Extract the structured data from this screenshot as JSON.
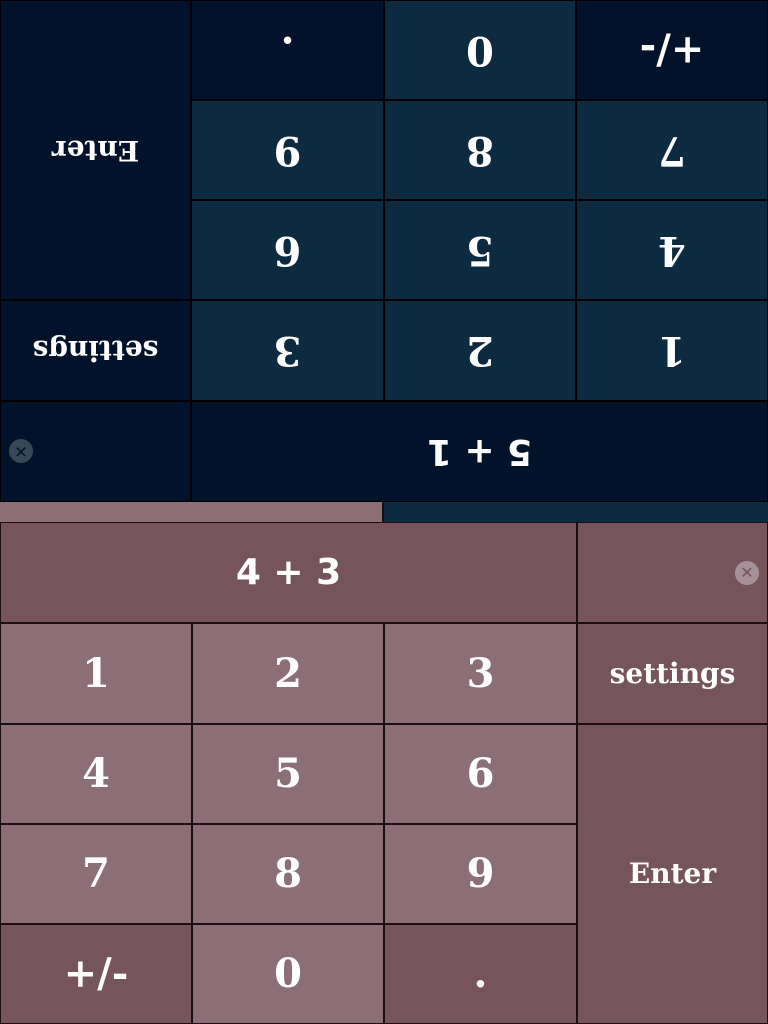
{
  "top_player": {
    "expression": "5 + 1",
    "keys": {
      "one": "1",
      "two": "2",
      "three": "3",
      "four": "4",
      "five": "5",
      "six": "6",
      "seven": "7",
      "eight": "8",
      "nine": "9",
      "zero": "0",
      "sign": "+/-",
      "decimal": "."
    },
    "settings_label": "settings",
    "enter_label": "Enter",
    "clear_symbol": "✕"
  },
  "bottom_player": {
    "expression": "4 + 3",
    "keys": {
      "one": "1",
      "two": "2",
      "three": "3",
      "four": "4",
      "five": "5",
      "six": "6",
      "seven": "7",
      "eight": "8",
      "nine": "9",
      "zero": "0",
      "sign": "+/-",
      "decimal": "."
    },
    "settings_label": "settings",
    "enter_label": "Enter",
    "clear_symbol": "✕"
  },
  "colors": {
    "bottom_key": "#8c6e77",
    "bottom_function": "#75545c",
    "top_key": "#0c2b40",
    "top_function": "#02122a"
  }
}
